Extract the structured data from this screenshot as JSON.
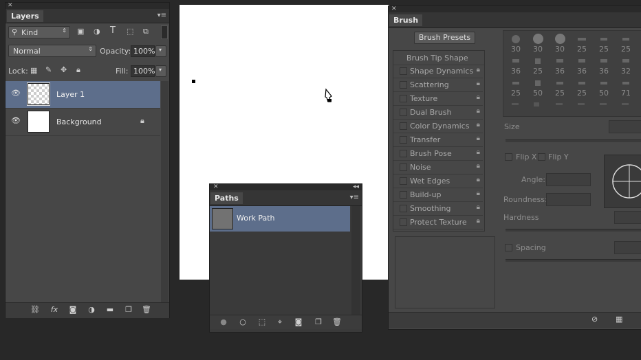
{
  "layers_panel": {
    "tab": "Layers",
    "filter_kind": "Kind",
    "blend_mode": "Normal",
    "opacity_label": "Opacity:",
    "opacity_value": "100%",
    "lock_label": "Lock:",
    "fill_label": "Fill:",
    "fill_value": "100%",
    "layers": [
      {
        "name": "Layer 1",
        "selected": true,
        "thumb": "transparent"
      },
      {
        "name": "Background",
        "selected": false,
        "thumb": "white",
        "locked": true
      }
    ],
    "footer_icons": [
      "link-icon",
      "fx-icon",
      "mask-icon",
      "adjustment-icon",
      "folder-icon",
      "new-layer-icon",
      "trash-icon"
    ]
  },
  "paths_panel": {
    "tab": "Paths",
    "paths": [
      {
        "name": "Work Path",
        "selected": true
      }
    ],
    "footer_icons": [
      "fill-path-icon",
      "stroke-path-icon",
      "load-selection-icon",
      "make-path-icon",
      "add-mask-icon",
      "new-path-icon",
      "trash-icon"
    ]
  },
  "brush_panel": {
    "tab": "Brush",
    "presets_button": "Brush Presets",
    "tip_shape_label": "Brush Tip Shape",
    "options": [
      "Shape Dynamics",
      "Scattering",
      "Texture",
      "Dual Brush",
      "Color Dynamics",
      "Transfer",
      "Brush Pose",
      "Noise",
      "Wet Edges",
      "Build-up",
      "Smoothing",
      "Protect Texture"
    ],
    "tip_rows": [
      [
        "30",
        "30",
        "30",
        "25",
        "25",
        "25"
      ],
      [
        "36",
        "25",
        "36",
        "36",
        "36",
        "32"
      ],
      [
        "25",
        "50",
        "25",
        "25",
        "50",
        "71"
      ]
    ],
    "size_label": "Size",
    "flip_x": "Flip X",
    "flip_y": "Flip Y",
    "angle_label": "Angle:",
    "roundness_label": "Roundness:",
    "hardness_label": "Hardness",
    "spacing_label": "Spacing"
  },
  "colors": {
    "selection": "#5d6e8b",
    "panel": "#474747",
    "canvas": "#ffffff"
  }
}
